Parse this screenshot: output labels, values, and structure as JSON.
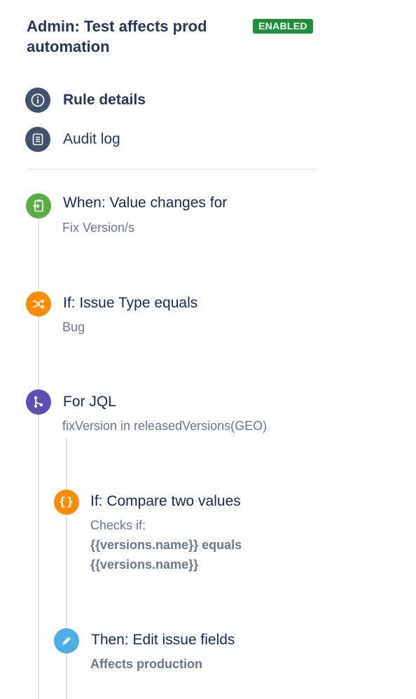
{
  "header": {
    "title_line1": "Admin: Test affects prod",
    "title_line2": "automation",
    "status_badge": "ENABLED"
  },
  "nav": {
    "rule_details": "Rule details",
    "audit_log": "Audit log"
  },
  "steps": [
    {
      "title": "When: Value changes for",
      "detail": "Fix Version/s",
      "icon": "trigger-icon",
      "color": "#5aac44"
    },
    {
      "title": "If: Issue Type equals",
      "detail": "Bug",
      "icon": "shuffle-icon",
      "color": "#ff8b00"
    },
    {
      "title": "For JQL",
      "detail": "fixVersion in releasedVersions(GEO)",
      "icon": "branch-icon",
      "color": "#5e4db2"
    },
    {
      "title": "If: Compare two values",
      "detail": "Checks if:",
      "detail_line2": "{{versions.name}} equals",
      "detail_line3": "{{versions.name}}",
      "icon": "braces-icon",
      "color": "#ff8b00"
    },
    {
      "title": "Then: Edit issue fields",
      "detail": "Affects production",
      "icon": "pencil-icon",
      "color": "#4fade6"
    }
  ]
}
